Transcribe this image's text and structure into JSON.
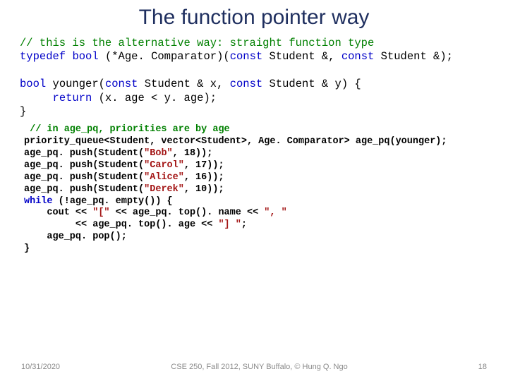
{
  "title": "The function pointer way",
  "code1": {
    "l1a": "// this is the alternative way: straight function type",
    "l2a": "typedef",
    "l2b": " ",
    "l2c": "bool",
    "l2d": " (*Age. Comparator)(",
    "l2e": "const",
    "l2f": " Student &, ",
    "l2g": "const",
    "l2h": " Student &);",
    "l3a": "bool",
    "l3b": " younger(",
    "l3c": "const",
    "l3d": " Student & x, ",
    "l3e": "const",
    "l3f": " Student & y) {",
    "l4a": "     ",
    "l4b": "return",
    "l4c": " (x. age < y. age);",
    "l5a": "}"
  },
  "code2": {
    "l1": " // in age_pq, priorities are by age",
    "l2": "priority_queue<Student, vector<Student>, Age. Comparator> age_pq(younger);",
    "l3a": "age_pq. push(Student(",
    "l3b": "\"Bob\"",
    "l3c": ", 18));",
    "l4a": "age_pq. push(Student(",
    "l4b": "\"Carol\"",
    "l4c": ", 17));",
    "l5a": "age_pq. push(Student(",
    "l5b": "\"Alice\"",
    "l5c": ", 16));",
    "l6a": "age_pq. push(Student(",
    "l6b": "\"Derek\"",
    "l6c": ", 10));",
    "l7a": "while",
    "l7b": " (!age_pq. empty()) {",
    "l8a": "    cout << ",
    "l8b": "\"[\"",
    "l8c": " << age_pq. top(). name << ",
    "l8d": "\", \"",
    "l9a": "         << age_pq. top(). age << ",
    "l9b": "\"] \"",
    "l9c": ";",
    "l10": "    age_pq. pop();",
    "l11": "}"
  },
  "footer": {
    "left": "10/31/2020",
    "center": "CSE 250, Fall 2012, SUNY Buffalo, © Hung Q. Ngo",
    "right": "18"
  }
}
